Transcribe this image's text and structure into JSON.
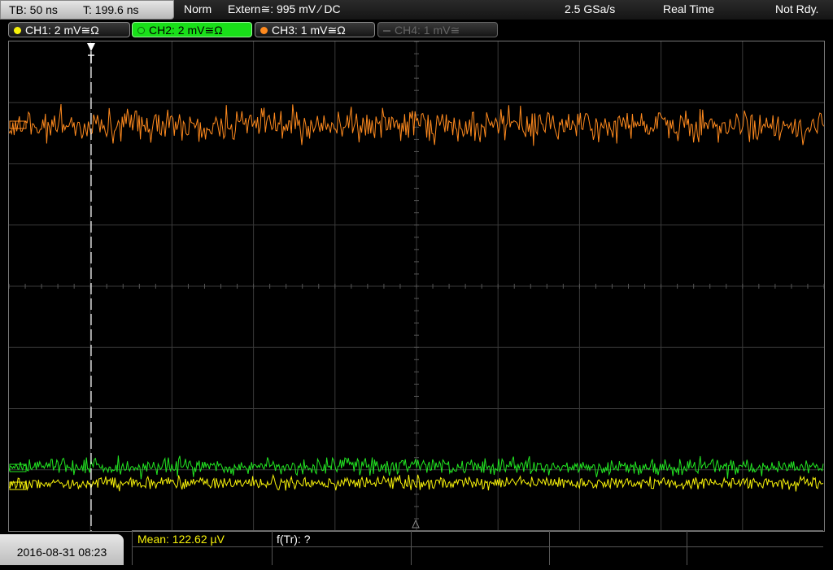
{
  "header": {
    "timebase": "TB: 50 ns",
    "trigger_time": "T: 199.6 ns",
    "trigger_mode": "Norm",
    "trigger_source": "Extern≅: 995 mV ⁄ DC",
    "sample_rate": "2.5 GSa/s",
    "acq_mode": "Real Time",
    "status": "Not Rdy."
  },
  "channels": [
    {
      "label": "CH1: 2 mV≅Ω",
      "color": "#f7f20a",
      "state": "on"
    },
    {
      "label": "CH2: 2 mV≅Ω",
      "color": "#22e622",
      "state": "selected"
    },
    {
      "label": "CH3: 1 mV≅Ω",
      "color": "#ff8a1e",
      "state": "on"
    },
    {
      "label": "CH4: 1 mV≅",
      "color": "#6a6a6a",
      "state": "off"
    }
  ],
  "footer": {
    "datetime": "2016-08-31 08:23",
    "measurement_1": "Mean: 122.62 µV",
    "measurement_2": "f(Tr): ?"
  },
  "colors": {
    "ch1": "#f7f20a",
    "ch2": "#22e622",
    "ch3": "#ff8a1e",
    "grid": "#3c3c3c",
    "trigger_marker": "#ffffff"
  },
  "icons": {
    "trigger_position": "trigger-position-icon",
    "reference_marker": "reference-marker-icon"
  }
}
